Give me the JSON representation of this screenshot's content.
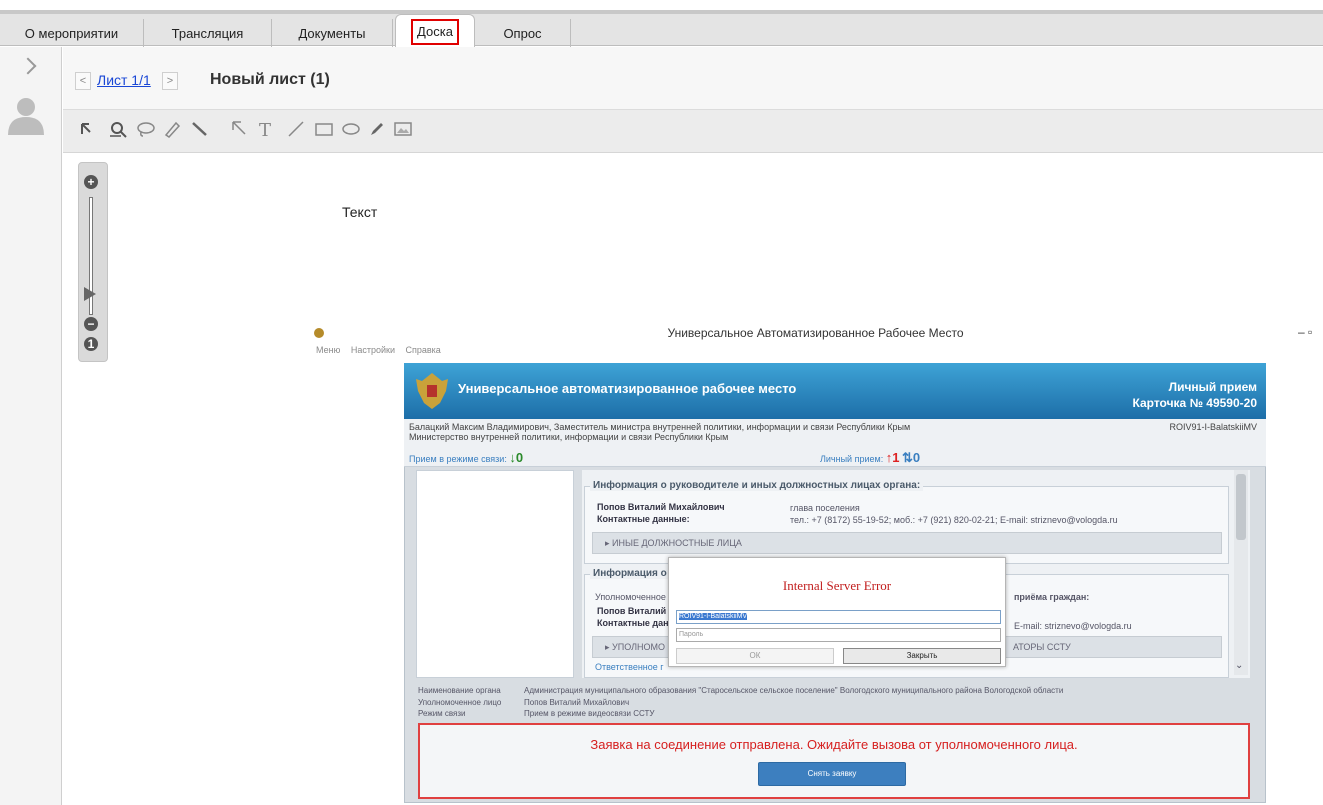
{
  "tabs": [
    {
      "label": "О мероприятии",
      "active": false
    },
    {
      "label": "Трансляция",
      "active": false
    },
    {
      "label": "Документы",
      "active": false
    },
    {
      "label": "Доска",
      "active": true
    },
    {
      "label": "Опрос",
      "active": false
    }
  ],
  "board": {
    "sheet_link": "Лист 1/1",
    "sheet_title": "Новый лист (1)",
    "canvas_text": "Текст"
  },
  "tools": [
    "pointer-icon",
    "zoom-area-icon",
    "lasso-icon",
    "highlighter-icon",
    "marker-icon",
    "arrow-icon",
    "text-icon",
    "line-icon",
    "rectangle-icon",
    "ellipse-icon",
    "pen-icon",
    "image-icon"
  ],
  "tool_glyphs": [
    "↱",
    "",
    "",
    "",
    "",
    "",
    "T",
    "╱",
    "",
    "",
    "",
    ""
  ],
  "zoom": {
    "plus": "+",
    "minus": "−",
    "one": "1"
  },
  "embedded": {
    "window_title": "Универсальное Автоматизированное Рабочее Место",
    "window_controls": "– ▫",
    "menu": [
      "Меню",
      "Настройки",
      "Справка"
    ],
    "banner_title": "Универсальное автоматизированное рабочее место",
    "banner_right_1": "Личный прием",
    "banner_right_2": "Карточка № 49590-20",
    "info_line_1": "Балацкий Максим Владимирович, Заместитель министра внутренней политики, информации и связи Республики Крым",
    "info_line_2": "Министерство внутренней политики, информации и связи Республики Крым",
    "user_id": "ROIV91-I-BalatskiiMV",
    "mode_video_label": "Прием в режиме связи:",
    "mode_video_count": "↓0",
    "mode_personal_label": "Личный прием:",
    "mode_personal_up": "↑1",
    "mode_personal_sync": "⇅0",
    "section1_title": "Информация о руководителе и иных должностных лицах органа:",
    "section1_name_label": "Попов Виталий Михайлович",
    "section1_name_value": "глава поселения",
    "section1_contacts_label": "Контактные данные:",
    "section1_contacts_value": "тел.: +7 (8172) 55-19-52; моб.: +7 (921) 820-02-21; E-mail: striznevo@vologda.ru",
    "section1_collapse": "▸ ИНЫЕ ДОЛЖНОСТНЫЕ ЛИЦА",
    "section2_title": "Информация о",
    "section2_row1": "Уполномоченное",
    "section2_row1_right": "приёма граждан:",
    "section2_row2": "Попов Виталий",
    "section2_row3": "Контактные дан",
    "section2_email": "E-mail: striznevo@vologda.ru",
    "section2_collapse": "▸ УПОЛНОМО",
    "section2_collapse_right": "АТОРЫ ССТУ",
    "section2_row4": "Ответственное г",
    "dialog_title": "Internal Server Error",
    "dialog_login": "ROIV91-I-BalatskiiMV",
    "dialog_password_placeholder": "Пароль",
    "dialog_ok": "ОК",
    "dialog_close": "Закрыть",
    "bottom": [
      {
        "k": "Наименование органа",
        "v": "Администрация муниципального образования \"Старосельское сельское поселение\" Вологодского муниципального района Вологодской области"
      },
      {
        "k": "Уполномоченное лицо",
        "v": "Попов Виталий Михайлович"
      },
      {
        "k": "Режим связи",
        "v": "Прием в режиме видеосвязи ССТУ"
      }
    ],
    "notice": "Заявка на соединение отправлена. Ожидайте вызова от уполномоченного лица.",
    "notice_button": "Снять заявку",
    "scroll_down": "⌄"
  }
}
